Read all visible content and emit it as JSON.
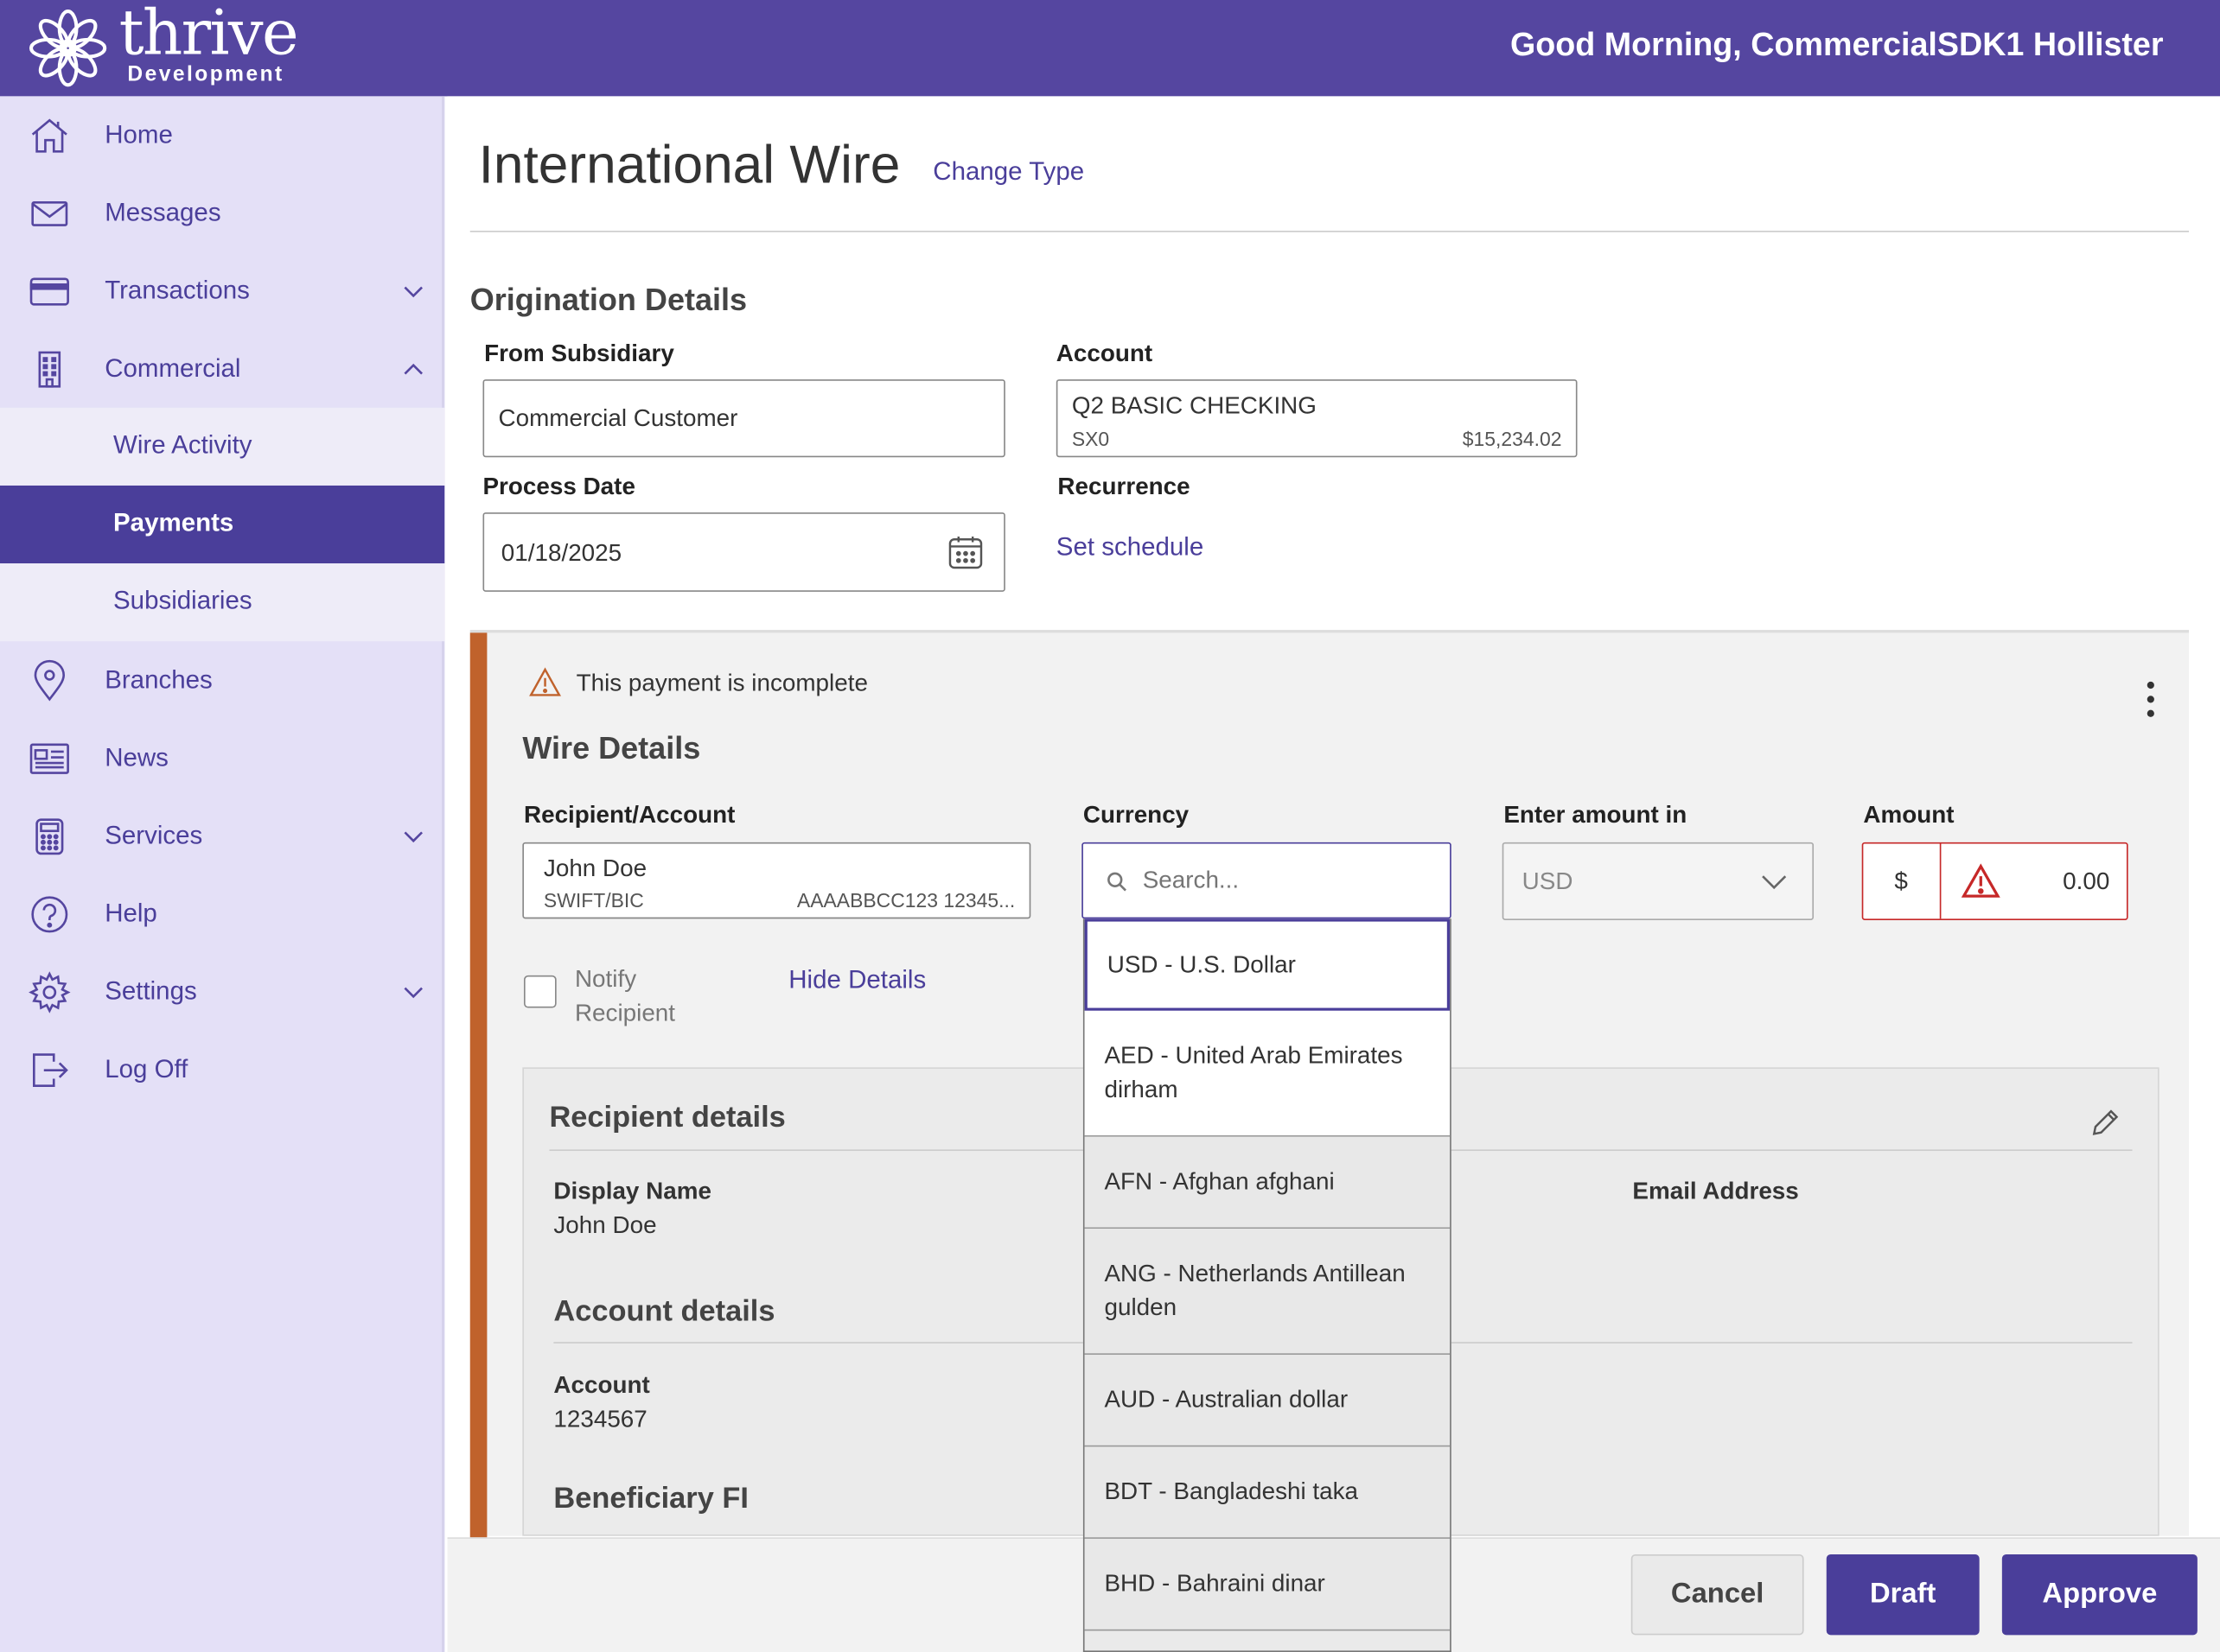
{
  "header": {
    "logo_word": "thrive",
    "logo_sub": "Development",
    "greeting": "Good Morning, CommercialSDK1 Hollister"
  },
  "sidebar": {
    "items": [
      {
        "label": "Home",
        "icon": "home-icon"
      },
      {
        "label": "Messages",
        "icon": "envelope-icon"
      },
      {
        "label": "Transactions",
        "icon": "card-icon"
      },
      {
        "label": "Commercial",
        "icon": "building-icon"
      },
      {
        "label": "Branches",
        "icon": "location-pin-icon"
      },
      {
        "label": "News",
        "icon": "newspaper-icon"
      },
      {
        "label": "Services",
        "icon": "calculator-icon"
      },
      {
        "label": "Help",
        "icon": "help-icon"
      },
      {
        "label": "Settings",
        "icon": "gear-icon"
      },
      {
        "label": "Log Off",
        "icon": "logout-icon"
      }
    ],
    "commercial_sub": [
      "Wire Activity",
      "Payments",
      "Subsidiaries"
    ]
  },
  "page": {
    "title": "International Wire",
    "change_type": "Change Type"
  },
  "origination": {
    "heading": "Origination Details",
    "from_subsidiary_label": "From Subsidiary",
    "from_subsidiary_value": "Commercial Customer",
    "account_label": "Account",
    "account_name": "Q2 BASIC CHECKING",
    "account_number": "SX0",
    "account_balance": "$15,234.02",
    "process_date_label": "Process Date",
    "process_date_value": "01/18/2025",
    "recurrence_label": "Recurrence",
    "set_schedule": "Set schedule"
  },
  "wire": {
    "incomplete_msg": "This payment is incomplete",
    "heading": "Wire Details",
    "recipient_label": "Recipient/Account",
    "recipient_name": "John Doe",
    "recipient_type": "SWIFT/BIC",
    "recipient_code": "AAAABBCC123 12345...",
    "currency_label": "Currency",
    "currency_placeholder": "Search...",
    "enter_amount_label": "Enter amount in",
    "enter_amount_value": "USD",
    "amount_label": "Amount",
    "amount_symbol": "$",
    "amount_value": "0.00",
    "notify_line1": "Notify",
    "notify_line2": "Recipient",
    "hide_details": "Hide Details"
  },
  "recipient_details": {
    "heading": "Recipient details",
    "display_name_label": "Display Name",
    "display_name_value": "John Doe",
    "email_label": "Email Address",
    "account_heading": "Account details",
    "account_label": "Account",
    "account_value": "1234567",
    "beneficiary_heading": "Beneficiary FI"
  },
  "currency_options": [
    {
      "line1": "USD - U.S. Dollar",
      "line2": ""
    },
    {
      "line1": "AED - United Arab Emirates",
      "line2": "dirham"
    },
    {
      "line1": "AFN - Afghan afghani",
      "line2": ""
    },
    {
      "line1": "ANG - Netherlands Antillean",
      "line2": "gulden"
    },
    {
      "line1": "AUD - Australian dollar",
      "line2": ""
    },
    {
      "line1": "BDT - Bangladeshi taka",
      "line2": ""
    },
    {
      "line1": "BHD - Bahraini dinar",
      "line2": ""
    }
  ],
  "footer": {
    "cancel": "Cancel",
    "draft": "Draft",
    "approve": "Approve"
  },
  "colors": {
    "brand": "#5546a0",
    "accent": "#4a3e9a",
    "warning": "#c0622c",
    "error": "#c62828"
  }
}
